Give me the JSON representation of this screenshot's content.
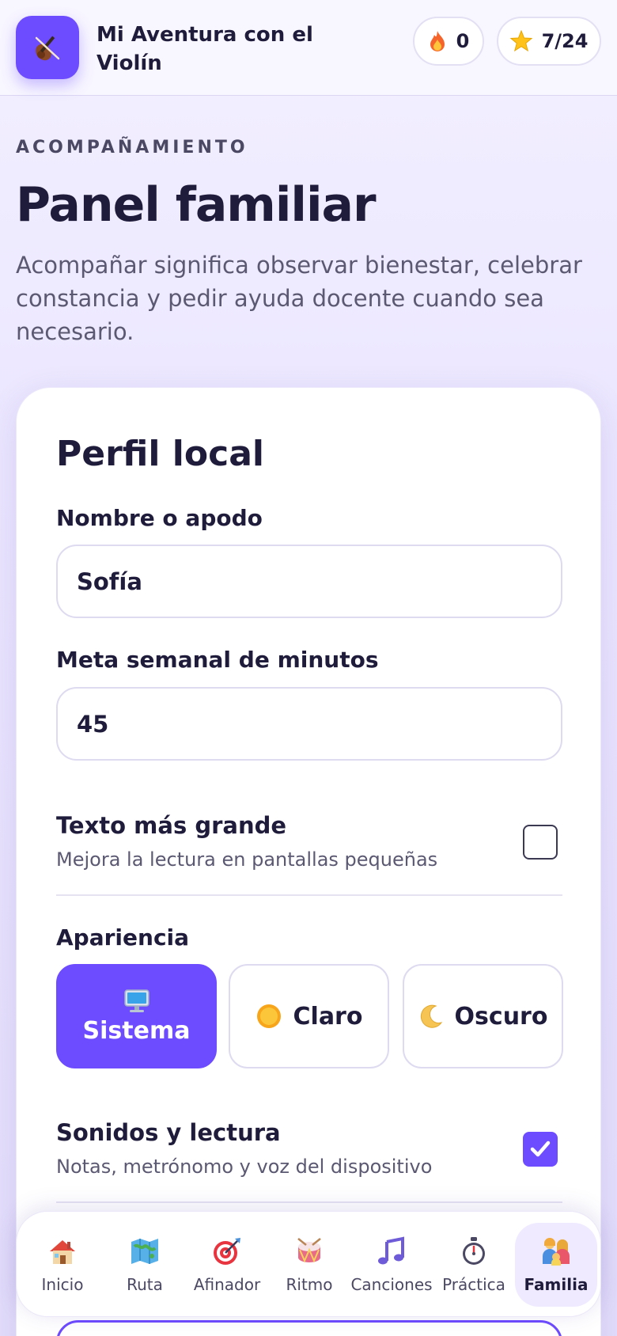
{
  "header": {
    "app_title": "Mi Aventura con el Violín",
    "app_icon": "violin-icon",
    "streak": "0",
    "streak_icon": "fire-icon",
    "stars": "7/24",
    "stars_icon": "star-icon"
  },
  "intro": {
    "eyebrow": "ACOMPAÑAMIENTO",
    "title": "Panel familiar",
    "description": "Acompañar significa observar bienestar, celebrar constancia y pedir ayuda docente cuando sea necesario."
  },
  "profile": {
    "title": "Perfil local",
    "name_label": "Nombre o apodo",
    "name_value": "Sofía",
    "goal_label": "Meta semanal de minutos",
    "goal_value": "45",
    "large_text": {
      "title": "Texto más grande",
      "subtitle": "Mejora la lectura en pantallas pequeñas",
      "checked": false
    },
    "appearance": {
      "label": "Apariencia",
      "options": [
        {
          "label": "Sistema",
          "icon": "monitor-icon",
          "selected": true
        },
        {
          "label": "Claro",
          "icon": "sun-icon",
          "selected": false
        },
        {
          "label": "Oscuro",
          "icon": "moon-icon",
          "selected": false
        }
      ]
    },
    "sound": {
      "title": "Sonidos y lectura",
      "subtitle": "Notas, metrónomo y voz del dispositivo",
      "checked": true
    }
  },
  "nav": {
    "items": [
      {
        "label": "Inicio",
        "icon": "house-icon",
        "active": false
      },
      {
        "label": "Ruta",
        "icon": "map-icon",
        "active": false
      },
      {
        "label": "Afinador",
        "icon": "target-icon",
        "active": false
      },
      {
        "label": "Ritmo",
        "icon": "drum-icon",
        "active": false
      },
      {
        "label": "Canciones",
        "icon": "music-note-icon",
        "active": false
      },
      {
        "label": "Práctica",
        "icon": "stopwatch-icon",
        "active": false
      },
      {
        "label": "Familia",
        "icon": "family-icon",
        "active": true
      }
    ]
  },
  "colors": {
    "accent": "#6d4bff",
    "text": "#1f1b3a",
    "muted": "#5b5872"
  }
}
